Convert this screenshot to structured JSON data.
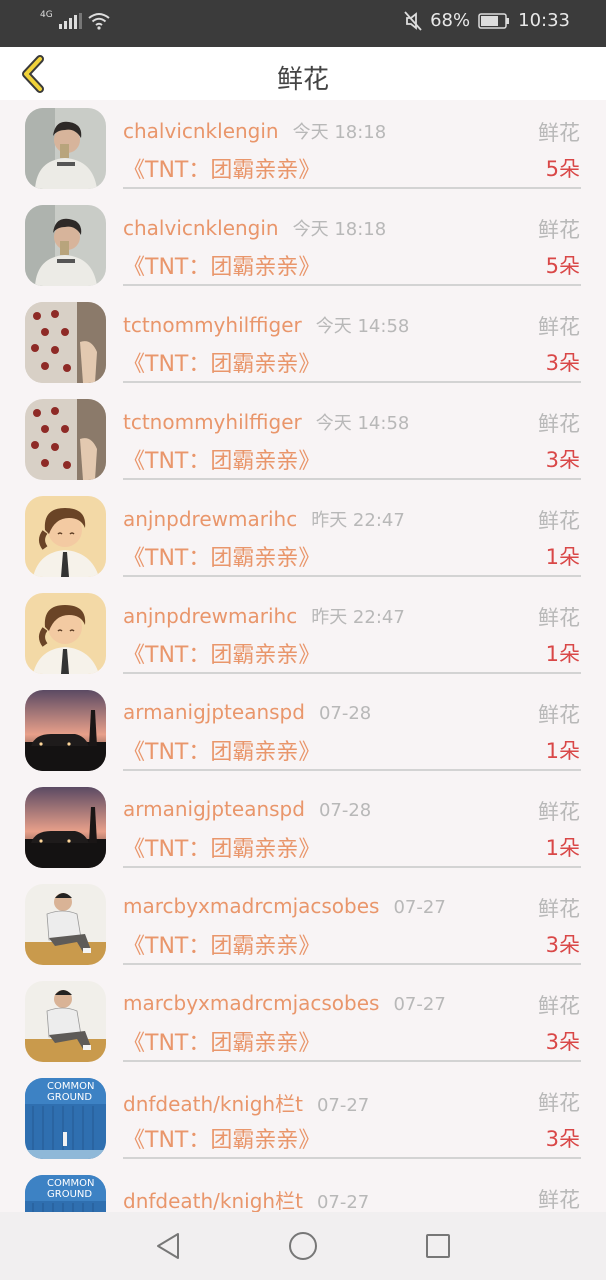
{
  "status_bar": {
    "network": "4G",
    "battery_percent": "68%",
    "time": "10:33",
    "icons": [
      "signal-icon",
      "wifi-icon",
      "mute-icon",
      "battery-icon"
    ]
  },
  "header": {
    "title": "鲜花",
    "back_icon": "chevron-left-icon"
  },
  "gifts": [
    {
      "username": "chalvicnklengin",
      "time": "今天 18:18",
      "gift_label": "鲜花",
      "work": "《TNT：团霸亲亲》",
      "count": "5朵",
      "avatar": "avatar-boy-selfie"
    },
    {
      "username": "chalvicnklengin",
      "time": "今天 18:18",
      "gift_label": "鲜花",
      "work": "《TNT：团霸亲亲》",
      "count": "5朵",
      "avatar": "avatar-boy-selfie"
    },
    {
      "username": "tctnommyhilffiger",
      "time": "今天 14:58",
      "gift_label": "鲜花",
      "work": "《TNT：团霸亲亲》",
      "count": "3朵",
      "avatar": "avatar-pattern-shirt"
    },
    {
      "username": "tctnommyhilffiger",
      "time": "今天 14:58",
      "gift_label": "鲜花",
      "work": "《TNT：团霸亲亲》",
      "count": "3朵",
      "avatar": "avatar-pattern-shirt"
    },
    {
      "username": "anjnpdrewmarihc",
      "time": "昨天 22:47",
      "gift_label": "鲜花",
      "work": "《TNT：团霸亲亲》",
      "count": "1朵",
      "avatar": "avatar-anime-boy"
    },
    {
      "username": "anjnpdrewmarihc",
      "time": "昨天 22:47",
      "gift_label": "鲜花",
      "work": "《TNT：团霸亲亲》",
      "count": "1朵",
      "avatar": "avatar-anime-boy"
    },
    {
      "username": "armanigjpteanspd",
      "time": "07-28",
      "gift_label": "鲜花",
      "work": "《TNT：团霸亲亲》",
      "count": "1朵",
      "avatar": "avatar-sunset-car"
    },
    {
      "username": "armanigjpteanspd",
      "time": "07-28",
      "gift_label": "鲜花",
      "work": "《TNT：团霸亲亲》",
      "count": "1朵",
      "avatar": "avatar-sunset-car"
    },
    {
      "username": "marcbyxmadrcmjacsobes",
      "time": "07-27",
      "gift_label": "鲜花",
      "work": "《TNT：团霸亲亲》",
      "count": "3朵",
      "avatar": "avatar-sitting-man"
    },
    {
      "username": "marcbyxmadrcmjacsobes",
      "time": "07-27",
      "gift_label": "鲜花",
      "work": "《TNT：团霸亲亲》",
      "count": "3朵",
      "avatar": "avatar-sitting-man"
    },
    {
      "username": "dnfdeath/knigh栏t",
      "time": "07-27",
      "gift_label": "鲜花",
      "work": "《TNT：团霸亲亲》",
      "count": "3朵",
      "avatar": "avatar-common-ground"
    },
    {
      "username": "dnfdeath/knigh栏t",
      "time": "07-27",
      "gift_label": "鲜花",
      "work": "",
      "count": "",
      "avatar": "avatar-common-ground"
    }
  ],
  "avatar_texts": {
    "common_ground_line1": "COMMON",
    "common_ground_line2": "GROUND"
  },
  "nav_bar": {
    "icons": [
      "back-triangle-icon",
      "home-circle-icon",
      "recents-square-icon"
    ]
  },
  "colors": {
    "username": "#e9966b",
    "count": "#d94747",
    "muted": "#b8b8b8",
    "back_arrow": "#f0d23a"
  }
}
